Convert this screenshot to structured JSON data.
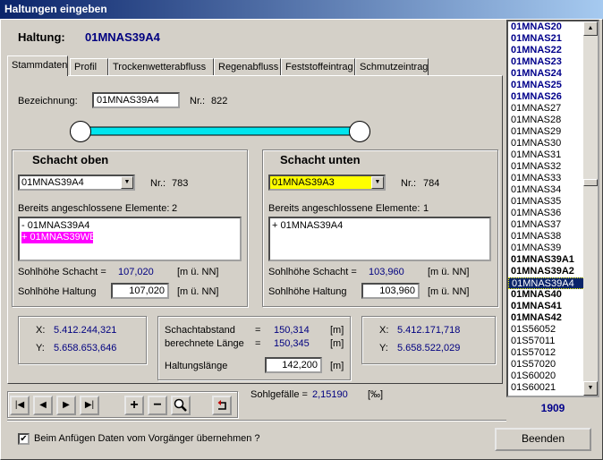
{
  "window": {
    "title": "Haltungen eingeben"
  },
  "header": {
    "label": "Haltung:",
    "value": "01MNAS39A4"
  },
  "tabs": [
    "Stammdaten",
    "Profil",
    "Trockenwetterabfluss",
    "Regenabfluss",
    "Feststoffeintrag",
    "Schmutzeintrag"
  ],
  "stammdaten": {
    "bezeichnung_label": "Bezeichnung:",
    "bezeichnung_value": "01MNAS39A4",
    "nr_label": "Nr.:",
    "nr_value": "822"
  },
  "schacht_oben": {
    "title": "Schacht oben",
    "combo_value": "01MNAS39A4",
    "nr_label": "Nr.:",
    "nr_value": "783",
    "connected_label": "Bereits angeschlossene Elemente:",
    "connected_count": "2",
    "connected_items": [
      "- 01MNAS39A4",
      "+ 01MNAS39WE"
    ],
    "sohlhoehe_schacht_label": "Sohlhöhe Schacht =",
    "sohlhoehe_schacht_value": "107,020",
    "unit": "[m ü. NN]",
    "sohlhoehe_haltung_label": "Sohlhöhe Haltung",
    "sohlhoehe_haltung_value": "107,020",
    "x_label": "X:",
    "x_value": "5.412.244,321",
    "y_label": "Y:",
    "y_value": "5.658.653,646"
  },
  "schacht_unten": {
    "title": "Schacht unten",
    "combo_value": "01MNAS39A3",
    "nr_label": "Nr.:",
    "nr_value": "784",
    "connected_label": "Bereits angeschlossene Elemente:",
    "connected_count": "1",
    "connected_items": [
      "+ 01MNAS39A4"
    ],
    "sohlhoehe_schacht_label": "Sohlhöhe Schacht =",
    "sohlhoehe_schacht_value": "103,960",
    "unit": "[m ü. NN]",
    "sohlhoehe_haltung_label": "Sohlhöhe Haltung",
    "sohlhoehe_haltung_value": "103,960",
    "x_label": "X:",
    "x_value": "5.412.171,718",
    "y_label": "Y:",
    "y_value": "5.658.522,029"
  },
  "lengths": {
    "schachtabstand_label": "Schachtabstand",
    "schachtabstand_value": "150,314",
    "berechnete_label": "berechnete Länge",
    "berechnete_value": "150,345",
    "haltungslaenge_label": "Haltungslänge",
    "haltungslaenge_value": "142,200",
    "eq": "=",
    "unit": "[m]"
  },
  "sohlgefaelle": {
    "label": "Sohlgefälle =",
    "value": "2,15190",
    "unit": "[‰]"
  },
  "footer": {
    "checkbox_label": "Beim Anfügen Daten vom Vorgänger übernehmen ?",
    "checkbox_checked": "✔",
    "beenden_label": "Beenden"
  },
  "right_list": {
    "items": [
      {
        "label": "01MNAS20",
        "style": "bluebold"
      },
      {
        "label": "01MNAS21",
        "style": "bluebold"
      },
      {
        "label": "01MNAS22",
        "style": "bluebold"
      },
      {
        "label": "01MNAS23",
        "style": "bluebold"
      },
      {
        "label": "01MNAS24",
        "style": "bluebold"
      },
      {
        "label": "01MNAS25",
        "style": "bluebold"
      },
      {
        "label": "01MNAS26",
        "style": "bluebold"
      },
      {
        "label": "01MNAS27",
        "style": "normal"
      },
      {
        "label": "01MNAS28",
        "style": "normal"
      },
      {
        "label": "01MNAS29",
        "style": "normal"
      },
      {
        "label": "01MNAS30",
        "style": "normal"
      },
      {
        "label": "01MNAS31",
        "style": "normal"
      },
      {
        "label": "01MNAS32",
        "style": "normal"
      },
      {
        "label": "01MNAS33",
        "style": "normal"
      },
      {
        "label": "01MNAS34",
        "style": "normal"
      },
      {
        "label": "01MNAS35",
        "style": "normal"
      },
      {
        "label": "01MNAS36",
        "style": "normal"
      },
      {
        "label": "01MNAS37",
        "style": "normal"
      },
      {
        "label": "01MNAS38",
        "style": "normal"
      },
      {
        "label": "01MNAS39",
        "style": "normal"
      },
      {
        "label": "01MNAS39A1",
        "style": "bold"
      },
      {
        "label": "01MNAS39A2",
        "style": "bold"
      },
      {
        "label": "01MNAS39A4",
        "style": "selected"
      },
      {
        "label": "01MNAS40",
        "style": "bold"
      },
      {
        "label": "01MNAS41",
        "style": "bold"
      },
      {
        "label": "01MNAS42",
        "style": "bold"
      },
      {
        "label": "01S56052",
        "style": "normal"
      },
      {
        "label": "01S57011",
        "style": "normal"
      },
      {
        "label": "01S57012",
        "style": "normal"
      },
      {
        "label": "01S57020",
        "style": "normal"
      },
      {
        "label": "01S60020",
        "style": "normal"
      },
      {
        "label": "01S60021",
        "style": "normal"
      }
    ],
    "count": "1909"
  },
  "colors": {
    "pipe": "#00e5ee",
    "magenta_highlight": "#ff00ff",
    "yellow_combo": "#ffff00",
    "value_blue": "#000080"
  }
}
